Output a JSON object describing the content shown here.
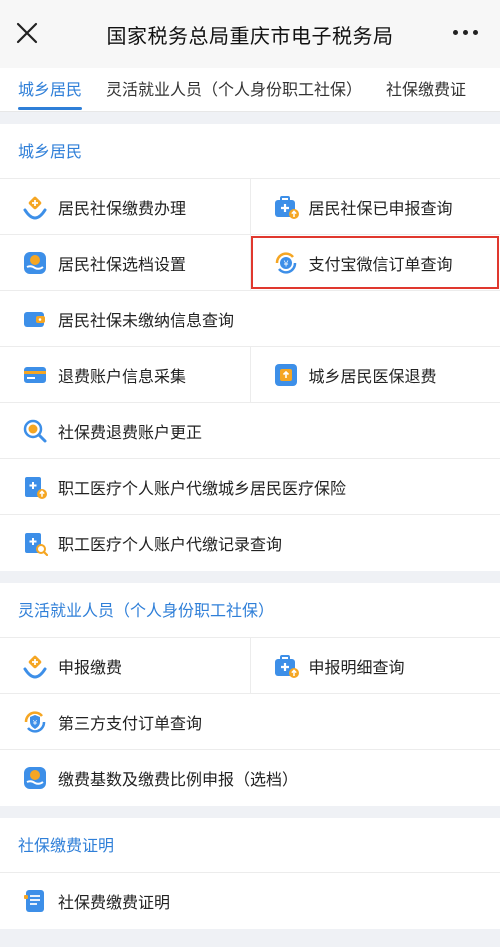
{
  "header": {
    "title": "国家税务总局重庆市电子税务局"
  },
  "tabs": [
    {
      "label": "城乡居民"
    },
    {
      "label": "灵活就业人员（个人身份职工社保）"
    },
    {
      "label": "社保缴费证"
    }
  ],
  "sections": [
    {
      "title": "城乡居民",
      "items": [
        {
          "label": "居民社保缴费办理",
          "icon": "hands-plus-icon"
        },
        {
          "label": "居民社保已申报查询",
          "icon": "medical-kit-icon"
        },
        {
          "label": "居民社保选档设置",
          "icon": "hand-money-icon"
        },
        {
          "label": "支付宝微信订单查询",
          "icon": "yuan-refresh-icon"
        },
        {
          "label": "居民社保未缴纳信息查询",
          "icon": "wallet-icon"
        },
        {
          "label": "退费账户信息采集",
          "icon": "card-icon"
        },
        {
          "label": "城乡居民医保退费",
          "icon": "refund-box-icon"
        },
        {
          "label": "社保费退费账户更正",
          "icon": "magnifier-icon"
        },
        {
          "label": "职工医疗个人账户代缴城乡居民医疗保险",
          "icon": "medical-doc-icon"
        },
        {
          "label": "职工医疗个人账户代缴记录查询",
          "icon": "medical-search-icon"
        }
      ]
    },
    {
      "title": "灵活就业人员（个人身份职工社保）",
      "items": [
        {
          "label": "申报缴费",
          "icon": "hands-plus-icon"
        },
        {
          "label": "申报明细查询",
          "icon": "medical-kit-icon"
        },
        {
          "label": "第三方支付订单查询",
          "icon": "yuan-shield-icon"
        },
        {
          "label": "缴费基数及缴费比例申报（选档）",
          "icon": "hand-money-icon"
        }
      ]
    },
    {
      "title": "社保缴费证明",
      "items": [
        {
          "label": "社保费缴费证明",
          "icon": "document-icon"
        }
      ]
    }
  ],
  "colors": {
    "accent": "#2f7fd8",
    "icon_blue": "#3d8fe8",
    "icon_orange": "#f5a623",
    "highlight": "#e0382e"
  }
}
